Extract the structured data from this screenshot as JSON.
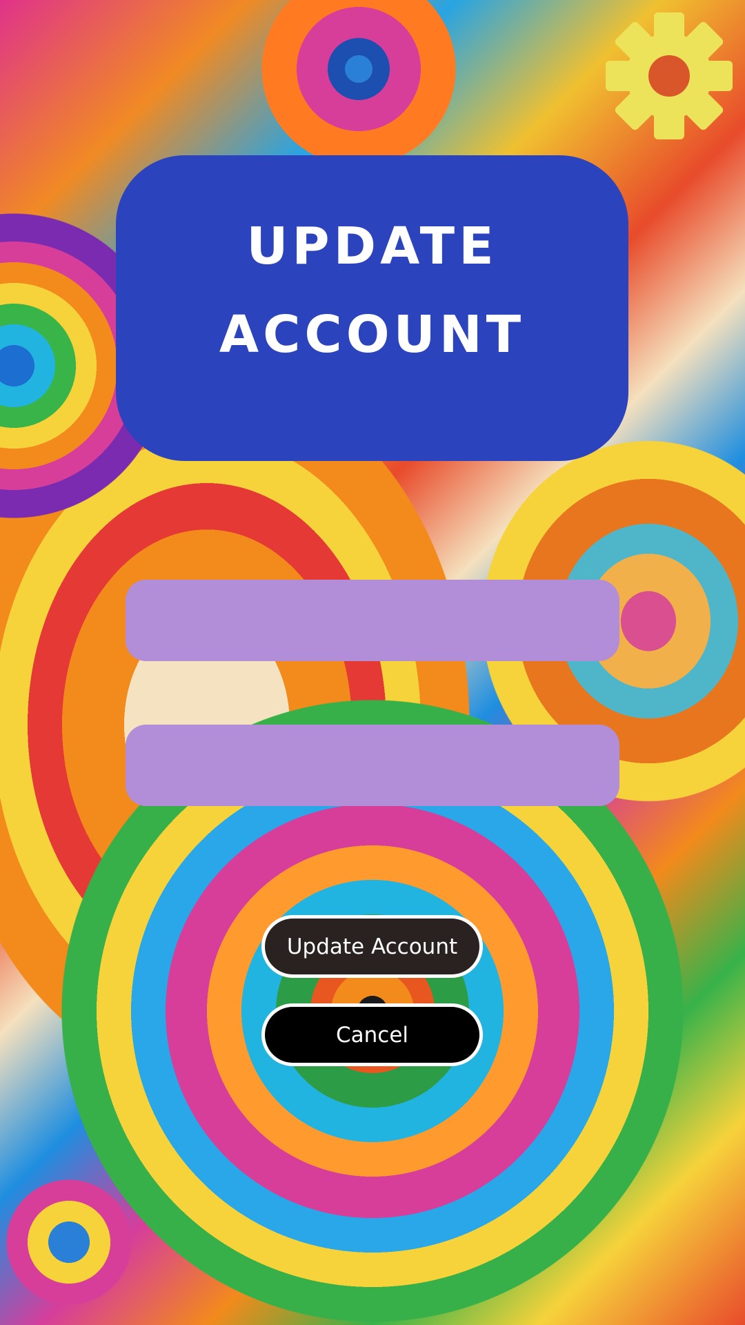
{
  "title": {
    "line1": "UPDATE",
    "line2": "ACCOUNT"
  },
  "settings": {
    "icon": "gear-icon",
    "color": "#ede35a"
  },
  "form": {
    "field1": {
      "value": "",
      "placeholder": ""
    },
    "field2": {
      "value": "",
      "placeholder": ""
    }
  },
  "buttons": {
    "update_label": "Update Account",
    "cancel_label": "Cancel"
  },
  "colors": {
    "title_card": "#2b43bc",
    "field_fill": "#b38ed8",
    "update_button": "#2a2121",
    "cancel_button": "#000000"
  }
}
